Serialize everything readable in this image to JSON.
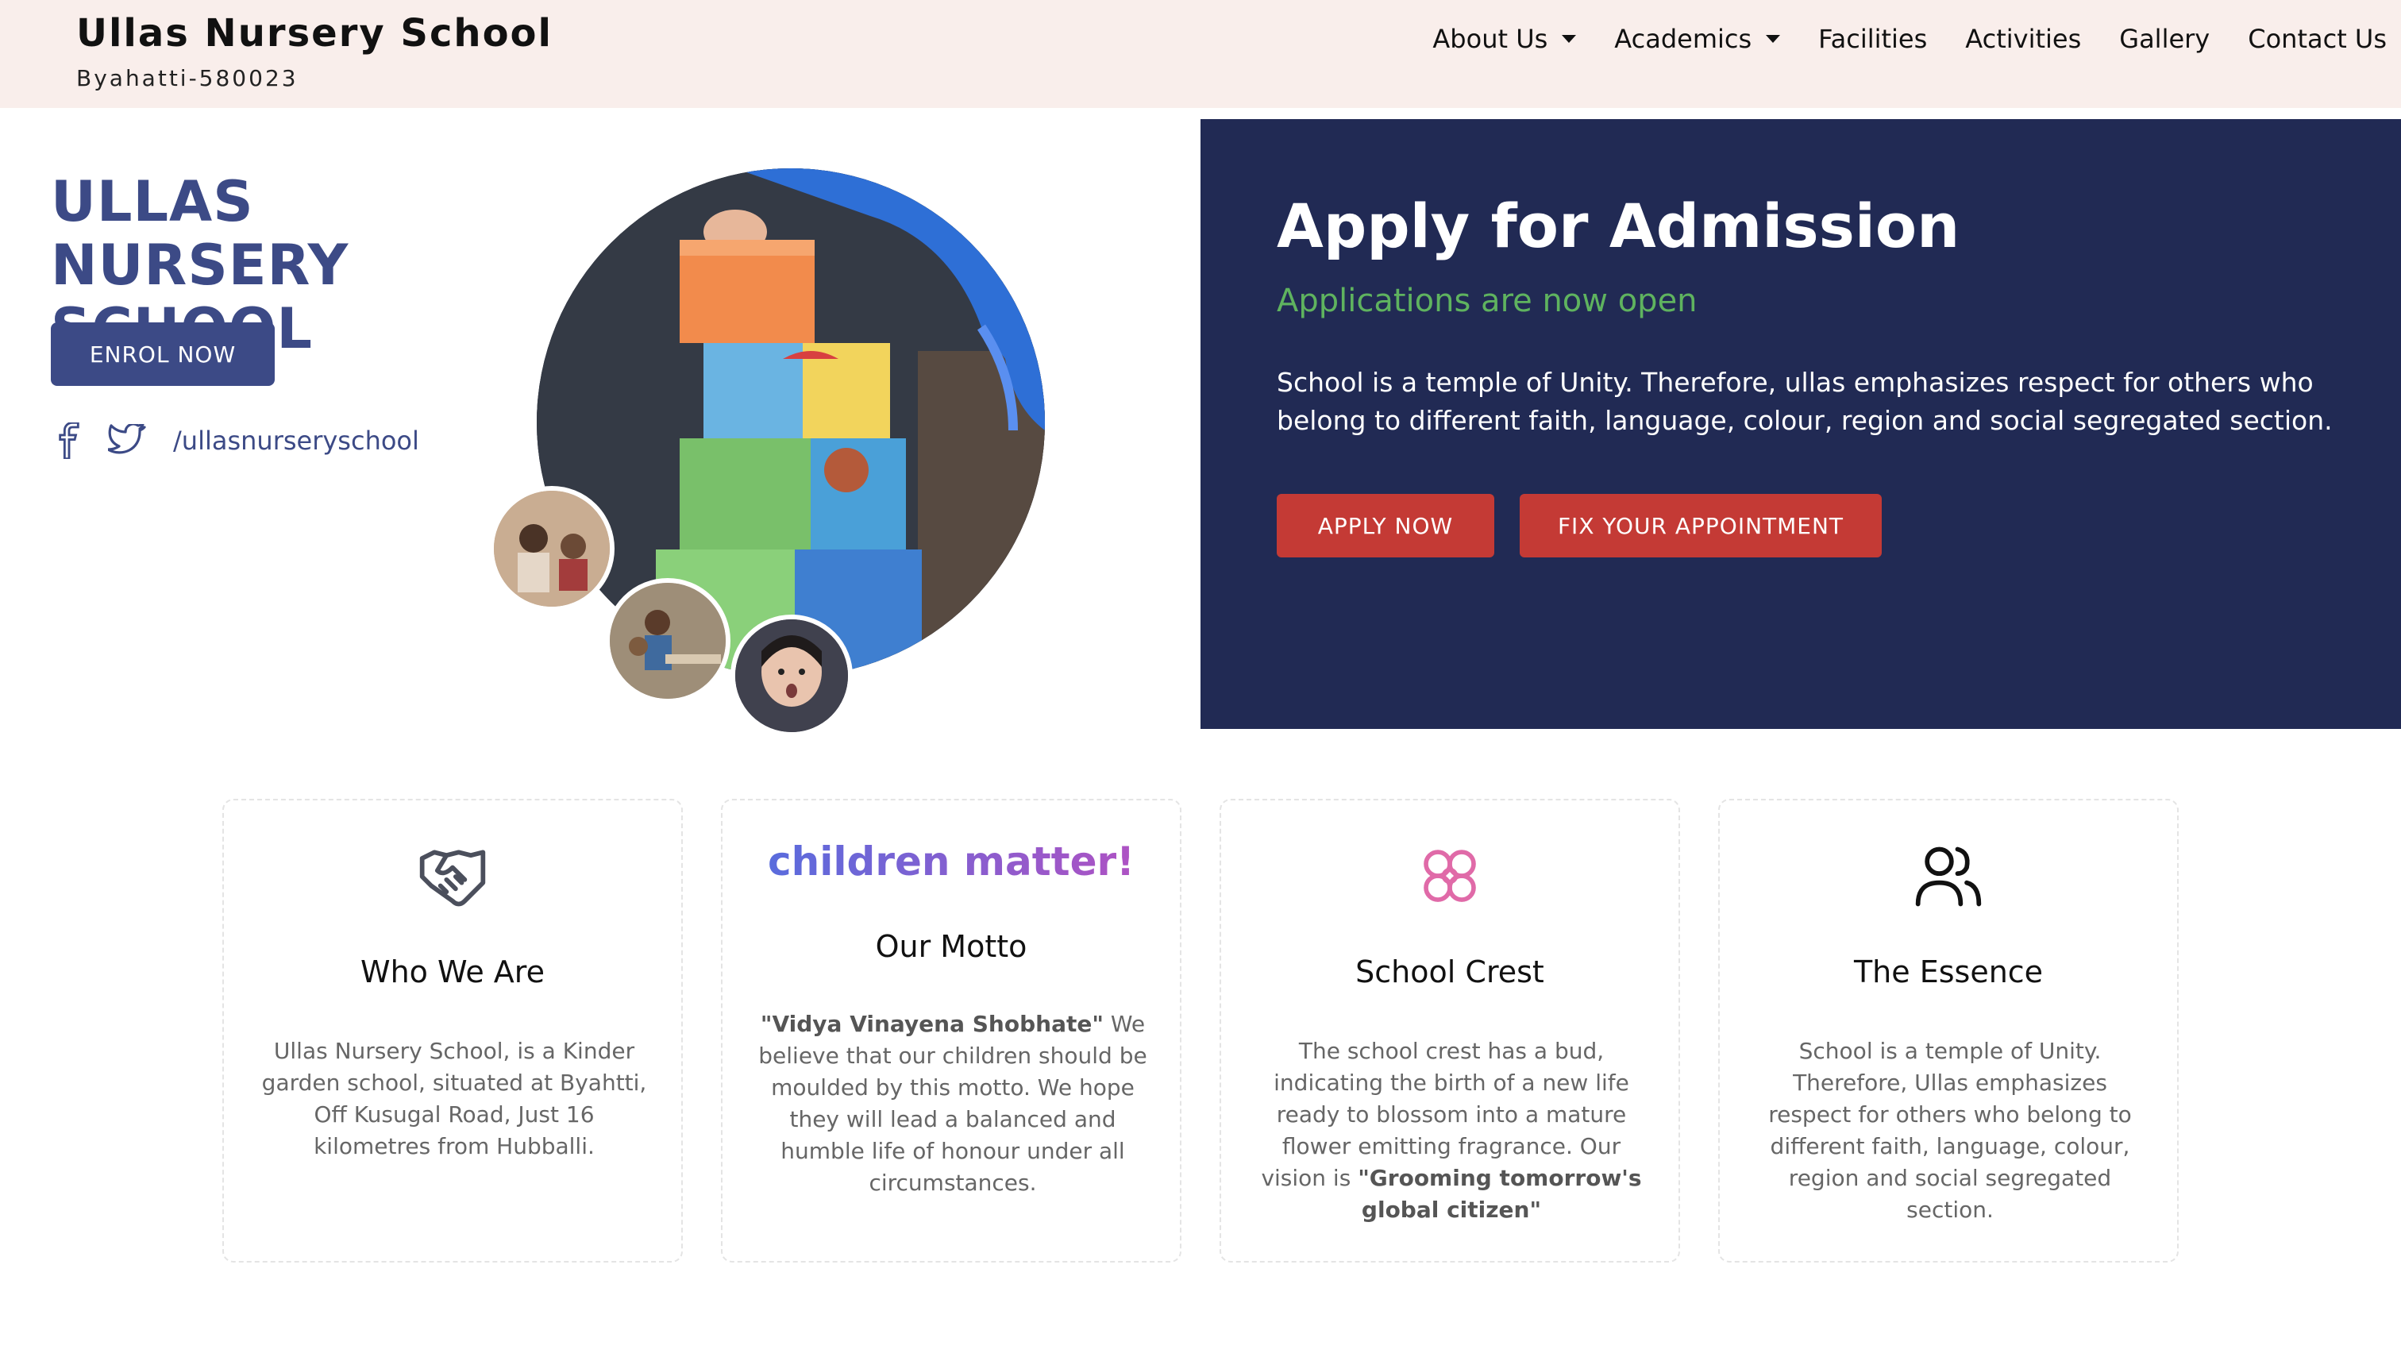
{
  "header": {
    "title": "Ullas Nursery School",
    "subtitle": "Byahatti-580023",
    "nav": [
      {
        "label": "About Us",
        "dropdown": true
      },
      {
        "label": "Academics",
        "dropdown": true
      },
      {
        "label": "Facilities",
        "dropdown": false
      },
      {
        "label": "Activities",
        "dropdown": false
      },
      {
        "label": "Gallery",
        "dropdown": false
      },
      {
        "label": "Contact Us",
        "dropdown": false
      }
    ]
  },
  "hero": {
    "title": "ULLAS NURSERY SCHOOL",
    "enrol_label": "ENROL NOW",
    "social_handle": "/ullasnurseryschool",
    "icons": [
      "facebook-icon",
      "twitter-icon"
    ]
  },
  "admission": {
    "title": "Apply for Admission",
    "subtitle": "Applications are now open",
    "body": "School is a temple of Unity. Therefore, ullas emphasizes respect for others who belong to different faith, language, colour, region and social segregated section.",
    "apply_label": "APPLY NOW",
    "appointment_label": "FIX YOUR APPOINTMENT"
  },
  "cards": [
    {
      "icon": "handshake-icon",
      "title": "Who We Are",
      "body": "Ullas Nursery School, is a Kinder garden school, situated at Byahtti, Off Kusugal Road, Just 16 kilometres from Hubballi."
    },
    {
      "tagline": "children matter!",
      "title": "Our Motto",
      "body_bold": "\"Vidya Vinayena Shobhate\"",
      "body": " We believe that our children should be moulded by this motto. We hope they will lead a balanced and humble life of honour under all circumstances."
    },
    {
      "icon": "flower-icon",
      "title": "School Crest",
      "body": "The school crest has a bud, indicating the birth of a new life ready to blossom into a mature flower emitting fragrance. Our vision is ",
      "body_bold": "\"Grooming tomorrow's global citizen\""
    },
    {
      "icon": "users-icon",
      "title": "The Essence",
      "body": "School is a temple of Unity. Therefore, Ullas emphasizes respect for others who belong to different faith, language, colour, region and social segregated section."
    }
  ],
  "colors": {
    "header_bg": "#f9eeeb",
    "brand_blue": "#3c4a86",
    "panel_navy": "#212a54",
    "accent_red": "#c43a35",
    "accent_green": "#5fb35f",
    "crest_pink": "#e06aa8"
  }
}
